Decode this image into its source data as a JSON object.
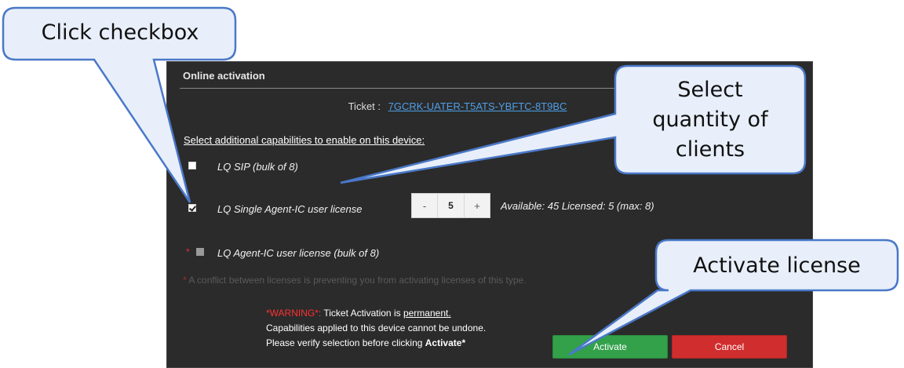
{
  "panel": {
    "title": "Online activation",
    "ticket_label": "Ticket :",
    "ticket_value": "7GCRK-UATER-T5ATS-YBFTC-8T9BC",
    "select_label": "Select additional capabilities to enable on this device:"
  },
  "capabilities": [
    {
      "label": "LQ SIP (bulk of 8)",
      "checked": false,
      "disabled": false
    },
    {
      "label": "LQ Single Agent-IC user license",
      "checked": true,
      "disabled": false
    },
    {
      "label": "LQ Agent-IC user license (bulk of 8)",
      "checked": false,
      "disabled": true,
      "asterisk": "*"
    }
  ],
  "stepper": {
    "minus": "-",
    "value": "5",
    "plus": "+"
  },
  "availability": "Available: 45   Licensed: 5 (max: 8)",
  "conflict": {
    "asterisk": "*",
    "text": " A conflict between licenses is preventing you from activating licenses of this type."
  },
  "warning": {
    "prefix": "*WARNING*:",
    "line1_text": " Ticket Activation is ",
    "line1_underline": "permanent.",
    "line2": "Capabilities applied to this device cannot be undone.",
    "line3_text": "Please verify selection before clicking ",
    "line3_bold": "Activate",
    "line3_end": "*"
  },
  "buttons": {
    "activate": "Activate",
    "cancel": "Cancel"
  },
  "callouts": {
    "checkbox": "Click checkbox",
    "quantity_line1": "Select",
    "quantity_line2": "quantity of",
    "quantity_line3": "clients",
    "activate": "Activate license"
  },
  "colors": {
    "panel_bg": "#2b2b2b",
    "link": "#4e9fe8",
    "activate": "#33a04a",
    "cancel": "#d02e2e",
    "warning": "#ff3030",
    "callout_fill": "#e8effa",
    "callout_border": "#4a78c8"
  }
}
